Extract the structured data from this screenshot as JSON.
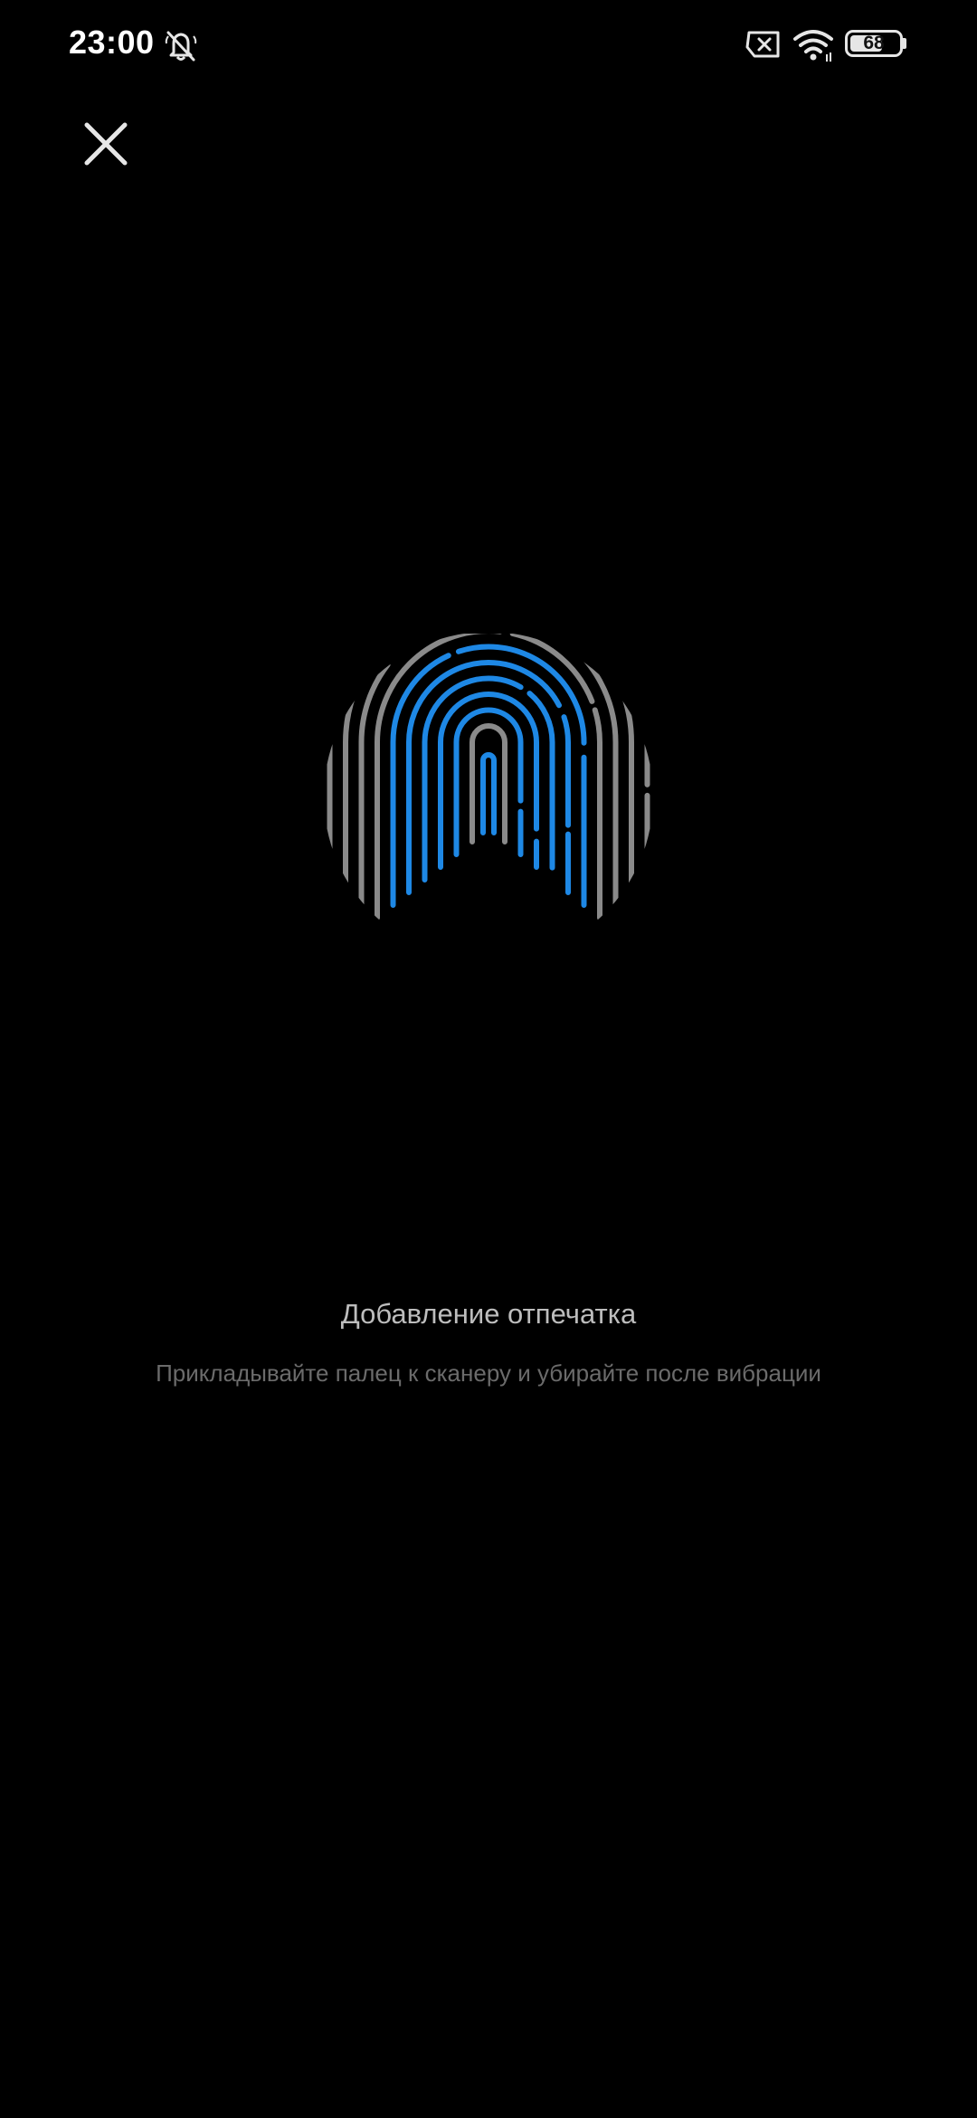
{
  "status_bar": {
    "time": "23:00",
    "battery_level": "68",
    "battery_fraction": 0.68,
    "icons": [
      "bell-off-icon",
      "no-sim-icon",
      "wifi-icon",
      "battery-icon"
    ]
  },
  "toolbar": {
    "close_icon": "close-icon"
  },
  "fingerprint": {
    "icon": "fingerprint-icon",
    "progress_color": "#1e88e5",
    "base_color": "#8a8a8a"
  },
  "content": {
    "title": "Добавление отпечатка",
    "subtitle": "Прикладывайте палец к сканеру и убирайте после вибрации"
  },
  "colors": {
    "background": "#000000",
    "title": "#bdbdbd",
    "subtitle": "#6b6b6b"
  }
}
